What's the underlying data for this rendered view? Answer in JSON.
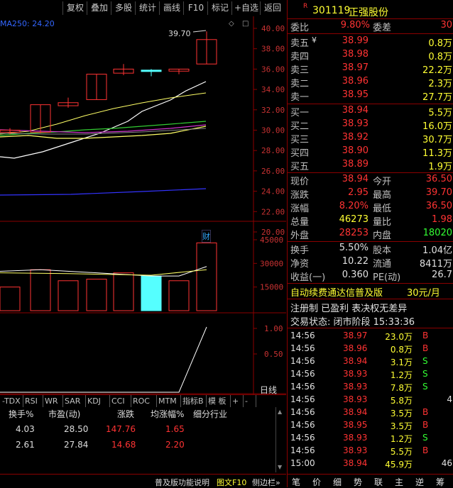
{
  "toolbar": {
    "buttons": [
      "复权",
      "叠加",
      "多股",
      "统计",
      "画线",
      "F10",
      "标记",
      "+自选",
      "返回"
    ]
  },
  "main_chart": {
    "ma_label": "MA250: 24.20",
    "price_ticks": [
      "40.00",
      "38.00",
      "36.00",
      "34.00",
      "32.00",
      "30.00",
      "28.00",
      "26.00",
      "24.00",
      "22.00",
      "20.00"
    ],
    "peak_label": "39.70",
    "finance_badge": "财",
    "volume_ticks": [
      "45000",
      "30000",
      "15000"
    ],
    "indicator_ticks": [
      "1.00",
      "0.50"
    ],
    "period_label": "日线"
  },
  "candles": [
    {
      "o": 30.0,
      "c": 29.8,
      "h": 30.2,
      "l": 29.6,
      "vol": 15000,
      "color": "red"
    },
    {
      "o": 29.8,
      "c": 32.5,
      "h": 32.5,
      "l": 29.7,
      "vol": 26000,
      "color": "red"
    },
    {
      "o": 32.4,
      "c": 32.7,
      "h": 33.2,
      "l": 32.2,
      "vol": 19000,
      "color": "red"
    },
    {
      "o": 33.0,
      "c": 35.5,
      "h": 35.5,
      "l": 33.0,
      "vol": 20000,
      "color": "red"
    },
    {
      "o": 35.6,
      "c": 36.0,
      "h": 36.5,
      "l": 35.4,
      "vol": 24000,
      "color": "red"
    },
    {
      "o": 35.9,
      "c": 35.9,
      "h": 36.0,
      "l": 35.3,
      "vol": 22000,
      "color": "cyan"
    },
    {
      "o": 35.8,
      "c": 36.0,
      "h": 36.0,
      "l": 35.5,
      "vol": 19000,
      "color": "red"
    },
    {
      "o": 36.5,
      "c": 38.9,
      "h": 39.7,
      "l": 36.5,
      "vol": 43000,
      "color": "red"
    }
  ],
  "tabs": [
    "-TDX",
    "RSI",
    "WR",
    "SAR",
    "KDJ",
    "CCI",
    "ROC",
    "MTM",
    "指标B",
    "模 板",
    "+",
    "-"
  ],
  "table": {
    "headers": [
      "换手%",
      "市盈(动)",
      "涨跌",
      "均涨幅%",
      "细分行业"
    ],
    "rows": [
      [
        "4.03",
        "28.50",
        "147.76",
        "1.65",
        ""
      ],
      [
        "2.61",
        "27.84",
        "14.68",
        "2.20",
        ""
      ]
    ]
  },
  "status_bar": {
    "help": "普及版功能说明",
    "f10": "图文F10",
    "side": "侧边栏»"
  },
  "quote": {
    "badge": "R",
    "code": "301119",
    "name": "正强股份",
    "weibi_label": "委比",
    "weibi": "9.80%",
    "weicha_label": "委差",
    "weicha": "30",
    "sell": [
      {
        "label": "卖五",
        "price": "38.99",
        "vol": "0.8万"
      },
      {
        "label": "卖四",
        "price": "38.98",
        "vol": "0.8万"
      },
      {
        "label": "卖三",
        "price": "38.97",
        "vol": "22.2万"
      },
      {
        "label": "卖二",
        "price": "38.96",
        "vol": "2.3万"
      },
      {
        "label": "卖一",
        "price": "38.95",
        "vol": "27.7万"
      }
    ],
    "sell5_mark": "¥",
    "buy": [
      {
        "label": "买一",
        "price": "38.94",
        "vol": "5.5万"
      },
      {
        "label": "买二",
        "price": "38.93",
        "vol": "16.0万"
      },
      {
        "label": "买三",
        "price": "38.92",
        "vol": "30.7万"
      },
      {
        "label": "买四",
        "price": "38.90",
        "vol": "11.3万"
      },
      {
        "label": "买五",
        "price": "38.89",
        "vol": "1.9万"
      }
    ],
    "stats": [
      {
        "l1": "现价",
        "v1": "38.94",
        "c1": "red",
        "l2": "今开",
        "v2": "36.50",
        "c2": "red"
      },
      {
        "l1": "涨跌",
        "v1": "2.95",
        "c1": "red",
        "l2": "最高",
        "v2": "39.70",
        "c2": "red"
      },
      {
        "l1": "涨幅",
        "v1": "8.20%",
        "c1": "red",
        "l2": "最低",
        "v2": "36.50",
        "c2": "red"
      },
      {
        "l1": "总量",
        "v1": "46273",
        "c1": "yel",
        "l2": "量比",
        "v2": "1.98",
        "c2": "red"
      },
      {
        "l1": "外盘",
        "v1": "28253",
        "c1": "red",
        "l2": "内盘",
        "v2": "18020",
        "c2": "green"
      }
    ],
    "stats2": [
      {
        "l1": "换手",
        "v1": "5.50%",
        "l2": "股本",
        "v2": "1.04亿"
      },
      {
        "l1": "净资",
        "v1": "10.22",
        "l2": "流通",
        "v2": "8411万"
      },
      {
        "l1": "收益(一)",
        "v1": "0.360",
        "l2": "PE(动)",
        "v2": "26.7"
      }
    ],
    "promo": "自动续费通达信普及版",
    "promo_price": "30元/月",
    "tags": "注册制 已盈利 表决权无差异",
    "trade_status": "交易状态: 闭市阶段 15:33:36"
  },
  "trades": [
    {
      "t": "14:56",
      "p": "38.97",
      "v": "23.0万",
      "s": "B",
      "n": ""
    },
    {
      "t": "14:56",
      "p": "38.96",
      "v": "0.8万",
      "s": "B",
      "n": ""
    },
    {
      "t": "14:56",
      "p": "38.94",
      "v": "3.1万",
      "s": "S",
      "n": ""
    },
    {
      "t": "14:56",
      "p": "38.93",
      "v": "1.2万",
      "s": "S",
      "n": ""
    },
    {
      "t": "14:56",
      "p": "38.93",
      "v": "7.8万",
      "s": "S",
      "n": ""
    },
    {
      "t": "14:56",
      "p": "38.93",
      "v": "5.8万",
      "s": "",
      "n": "4"
    },
    {
      "t": "14:56",
      "p": "38.94",
      "v": "3.5万",
      "s": "B",
      "n": ""
    },
    {
      "t": "14:56",
      "p": "38.95",
      "v": "3.5万",
      "s": "B",
      "n": ""
    },
    {
      "t": "14:56",
      "p": "38.93",
      "v": "1.2万",
      "s": "S",
      "n": ""
    },
    {
      "t": "14:56",
      "p": "38.93",
      "v": "5.5万",
      "s": "B",
      "n": ""
    },
    {
      "t": "15:00",
      "p": "38.94",
      "v": "45.9万",
      "s": "",
      "n": "46"
    }
  ],
  "right_tabs": [
    "笔",
    "价",
    "细",
    "势",
    "联",
    "主",
    "逆",
    "筹"
  ]
}
